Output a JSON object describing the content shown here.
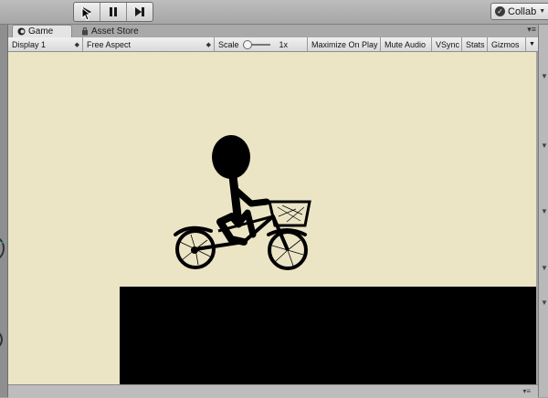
{
  "toolbar": {
    "collab_label": "Collab"
  },
  "tabs": {
    "game_label": "Game",
    "asset_store_label": "Asset Store"
  },
  "game_toolbar": {
    "display": "Display 1",
    "aspect": "Free Aspect",
    "scale_label": "Scale",
    "scale_value": "1x",
    "scale_level": 0.0,
    "maximize_on_play": "Maximize On Play",
    "mute_audio": "Mute Audio",
    "vsync": "VSync",
    "stats": "Stats",
    "gizmos": "Gizmos"
  },
  "colors": {
    "viewport_bg": "#ebe5c6",
    "ground": "#000000",
    "editor_bg": "#a2a2a2"
  },
  "icons": [
    "play-icon",
    "pause-icon",
    "step-icon",
    "check-circle-icon",
    "game-controller-icon",
    "shopping-bag-icon",
    "tab-menu-icon",
    "mouse-cursor-icon"
  ]
}
